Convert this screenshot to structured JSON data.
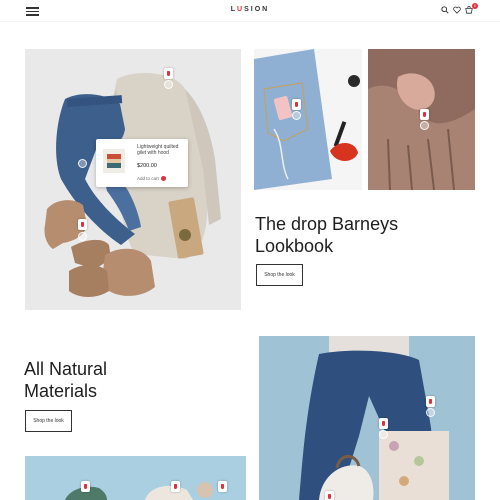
{
  "header": {
    "logo_pre": "L",
    "logo_accent": "U",
    "logo_post": "SION",
    "cart_count": "0",
    "icons": [
      "menu-icon",
      "search-icon",
      "heart-icon",
      "cart-icon"
    ]
  },
  "popup": {
    "title": "Lightweight quilted gilet with hood",
    "price": "$200.00",
    "add_to_cart": "Add to cart"
  },
  "section1": {
    "heading_line1": "The drop Barneys",
    "heading_line2": "Lookbook",
    "button": "Shop the look"
  },
  "section2": {
    "heading_line1": "All Natural",
    "heading_line2": "Materials",
    "button": "Shop the look"
  },
  "colors": {
    "accent": "#e0303d",
    "text": "#1e1e1e",
    "denim": "#5b7fa8"
  }
}
